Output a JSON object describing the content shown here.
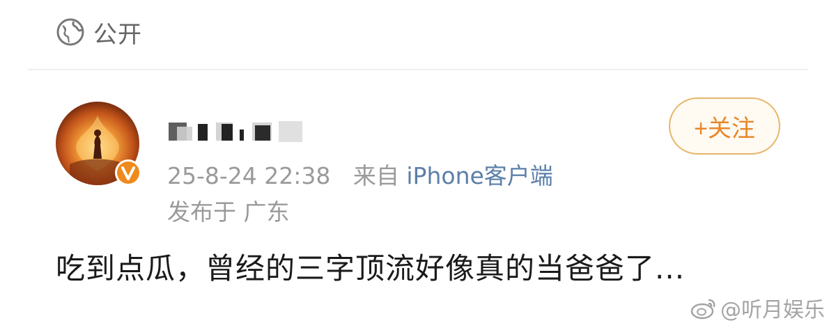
{
  "visibility": {
    "icon": "globe-icon",
    "label": "公开"
  },
  "post": {
    "author": {
      "avatar": "avatar-image",
      "verified_icon": "verified-badge-icon",
      "name_obscured": true
    },
    "follow_button": {
      "label": "+关注"
    },
    "timestamp": "25-8-24 22:38",
    "source_prefix": "来自",
    "source_client": "iPhone客户端",
    "location": "发布于 广东",
    "text": "吃到点瓜，曾经的三字顶流好像真的当爸爸了..."
  },
  "watermark": {
    "icon": "weibo-icon",
    "text": "@听月娱乐"
  },
  "colors": {
    "accent_orange": "#e8872a",
    "follow_border": "#e6b66a",
    "meta_gray": "#9a9a9a",
    "client_blue": "#5b7fa8",
    "badge_orange": "#f08a1c"
  }
}
